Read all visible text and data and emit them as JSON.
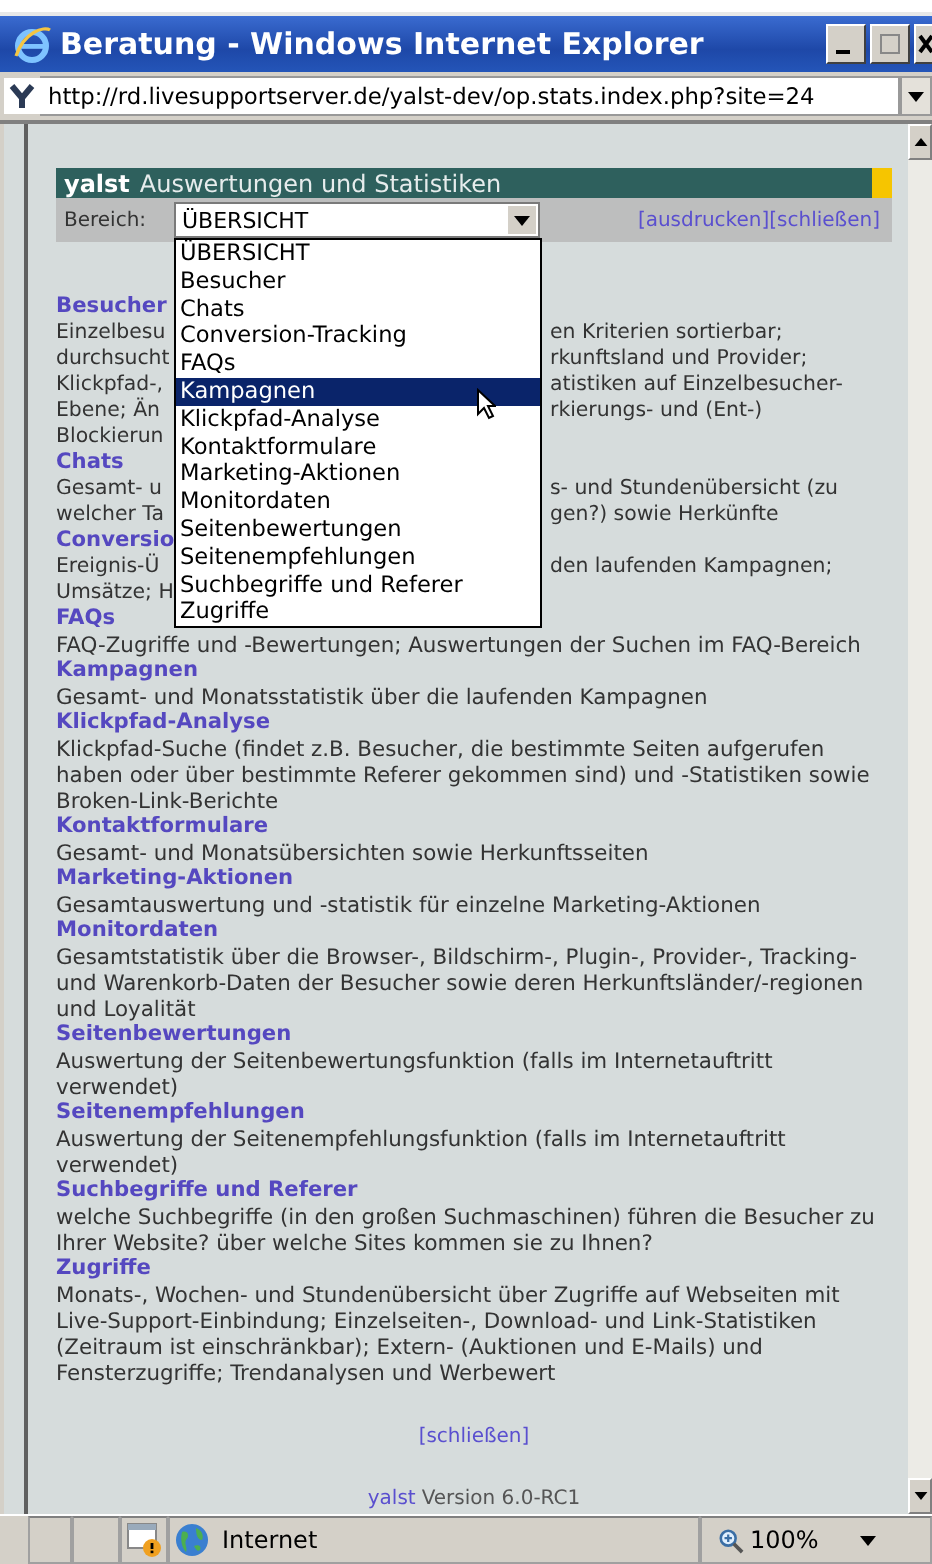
{
  "window": {
    "title": "Beratung - Windows Internet Explorer"
  },
  "address_bar": {
    "url": "http://rd.livesupportserver.de/yalst-dev/op.stats.index.php?site=24"
  },
  "header": {
    "brand": "yalst",
    "title": "Auswertungen und Statistiken"
  },
  "toolbar": {
    "label": "Bereich:",
    "select_value": "ÜBERSICHT",
    "links": [
      {
        "label": "[ausdrucken]"
      },
      {
        "label": "[schließen]"
      }
    ]
  },
  "dropdown": {
    "options": [
      {
        "label": "ÜBERSICHT",
        "selected": false
      },
      {
        "label": "Besucher",
        "selected": false
      },
      {
        "label": "Chats",
        "selected": false
      },
      {
        "label": "Conversion-Tracking",
        "selected": false
      },
      {
        "label": "FAQs",
        "selected": false
      },
      {
        "label": "Kampagnen",
        "selected": true
      },
      {
        "label": "Klickpfad-Analyse",
        "selected": false
      },
      {
        "label": "Kontaktformulare",
        "selected": false
      },
      {
        "label": "Marketing-Aktionen",
        "selected": false
      },
      {
        "label": "Monitordaten",
        "selected": false
      },
      {
        "label": "Seitenbewertungen",
        "selected": false
      },
      {
        "label": "Seitenempfehlungen",
        "selected": false
      },
      {
        "label": "Suchbegriffe und Referer",
        "selected": false
      },
      {
        "label": "Zugriffe",
        "selected": false
      }
    ]
  },
  "sections": [
    {
      "heading": "Besucher",
      "lines": [
        {
          "left": "Einzelbesu",
          "right": "en Kriterien sortierbar;"
        },
        {
          "left": "durchsucht",
          "right": "rkunftsland und Provider;"
        },
        {
          "left": "Klickpfad-,",
          "right": "atistiken auf Einzelbesucher-"
        },
        {
          "left": "Ebene; Än",
          "right": "rkierungs- und (Ent-)"
        },
        {
          "left": "Blockierun"
        }
      ]
    },
    {
      "heading": "Chats",
      "lines": [
        {
          "left": "Gesamt- u",
          "right": "s- und Stundenübersicht (zu"
        },
        {
          "left": "welcher Ta",
          "right": "gen?) sowie Herkünfte"
        }
      ]
    },
    {
      "heading": "Conversio",
      "lines": [
        {
          "left": "Ereignis-Ü",
          "right": "den laufenden Kampagnen;"
        },
        {
          "left": "Umsätze; H"
        }
      ]
    },
    {
      "heading": "FAQs",
      "description": "FAQ-Zugriffe und -Bewertungen; Auswertungen der Suchen im FAQ-Bereich"
    },
    {
      "heading": "Kampagnen",
      "description": "Gesamt- und Monatsstatistik über die laufenden Kampagnen"
    },
    {
      "heading": "Klickpfad-Analyse",
      "description": "Klickpfad-Suche (findet z.B. Besucher, die bestimmte Seiten aufgerufen haben oder über bestimmte Referer gekommen sind) und -Statistiken sowie Broken-Link-Berichte"
    },
    {
      "heading": "Kontaktformulare",
      "description": "Gesamt- und Monatsübersichten sowie Herkunftsseiten"
    },
    {
      "heading": "Marketing-Aktionen",
      "description": "Gesamtauswertung und -statistik für einzelne Marketing-Aktionen"
    },
    {
      "heading": "Monitordaten",
      "description": "Gesamtstatistik über die Browser-, Bildschirm-, Plugin-, Provider-, Tracking- und Warenkorb-Daten der Besucher sowie deren Herkunftsländer/-regionen und Loyalität"
    },
    {
      "heading": "Seitenbewertungen",
      "description": "Auswertung der Seitenbewertungsfunktion (falls im Internetauftritt verwendet)"
    },
    {
      "heading": "Seitenempfehlungen",
      "description": "Auswertung der Seitenempfehlungsfunktion (falls im Internetauftritt verwendet)"
    },
    {
      "heading": "Suchbegriffe und Referer",
      "description": "welche Suchbegriffe (in den großen Suchmaschinen) führen die Besucher zu Ihrer Website? über welche Sites kommen sie zu Ihnen?"
    },
    {
      "heading": "Zugriffe",
      "description": "Monats-, Wochen- und Stundenübersicht über Zugriffe auf Webseiten mit Live-Support-Einbindung; Einzelseiten-, Download- und Link-Statistiken (Zeitraum ist einschränkbar); Extern- (Auktionen und E-Mails) und Fensterzugriffe; Trendanalysen und Werbewert"
    }
  ],
  "close_link": "[schließen]",
  "footer": {
    "brand": "yalst",
    "version": "Version 6.0-RC1"
  },
  "status_bar": {
    "zone": "Internet",
    "zoom": "100%"
  }
}
